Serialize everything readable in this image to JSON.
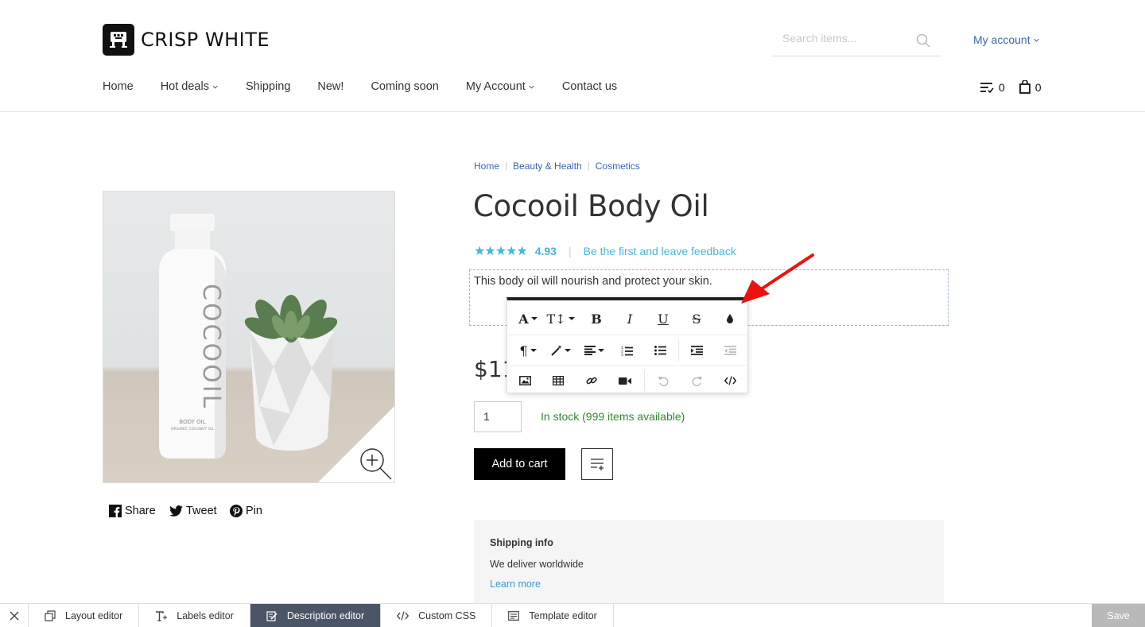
{
  "header": {
    "logo_text": "CRISP WHITE",
    "search_placeholder": "Search items...",
    "account_label": "My account"
  },
  "nav": {
    "items": [
      {
        "label": "Home"
      },
      {
        "label": "Hot deals"
      },
      {
        "label": "Shipping"
      },
      {
        "label": "New!"
      },
      {
        "label": "Coming soon"
      },
      {
        "label": "My Account"
      },
      {
        "label": "Contact us"
      }
    ],
    "wishlist_count": "0",
    "cart_count": "0"
  },
  "breadcrumb": [
    "Home",
    "Beauty & Health",
    "Cosmetics"
  ],
  "product": {
    "title": "Cocooil Body Oil",
    "rating": "4.93",
    "feedback_link": "Be the first and leave feedback",
    "description": "This body oil will nourish and protect your skin.",
    "price_visible": "$11",
    "quantity": "1",
    "stock": "In stock (999 items available)",
    "add_to_cart": "Add to cart",
    "bottle_brand": "COCOOIL",
    "bottle_sub1": "BODY OIL",
    "bottle_sub2": "ORGANIC COCONUT OIL"
  },
  "share": {
    "share": "Share",
    "tweet": "Tweet",
    "pin": "Pin"
  },
  "shipping": {
    "title": "Shipping info",
    "text": "We deliver worldwide",
    "link": "Learn more"
  },
  "editor_bar": {
    "items": [
      {
        "label": "Layout editor"
      },
      {
        "label": "Labels editor"
      },
      {
        "label": "Description editor"
      },
      {
        "label": "Custom CSS"
      },
      {
        "label": "Template editor"
      }
    ],
    "save": "Save"
  },
  "colors": {
    "accent_blue": "#3a66a8",
    "rating_cyan": "#47b6d8",
    "stock_green": "#2e8b2e",
    "editor_active": "#4a5565",
    "arrow_red": "#ee1111"
  }
}
